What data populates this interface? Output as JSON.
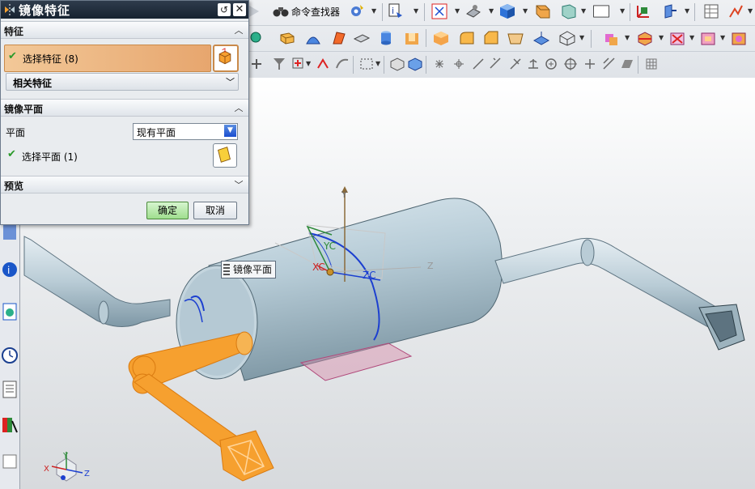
{
  "dialog": {
    "title": "镜像特征",
    "sections": {
      "features": {
        "header": "特征",
        "select_feature": "选择特征 (8)",
        "related_features": "相关特征"
      },
      "mirror_plane": {
        "header": "镜像平面",
        "plane_label": "平面",
        "plane_value": "现有平面",
        "select_plane": "选择平面 (1)"
      },
      "preview": {
        "header": "预览"
      }
    },
    "ok_label": "确定",
    "cancel_label": "取消"
  },
  "toolbar": {
    "command_finder_label": "命令查找器"
  },
  "viewport": {
    "tooltip": "镜像平面",
    "axis_labels": {
      "xc": "XC",
      "yc": "YC",
      "zc": "ZC",
      "y": "Y",
      "z": "Z",
      "x": "X"
    }
  },
  "colors": {
    "body_fill": "#b9ccd6",
    "body_dark": "#8aa3b0",
    "mirror_feature": "#f6a02f",
    "plane": "#d68aa8",
    "edge_highlight": "#1c3fd0",
    "dialog_selected": "#ebb07a"
  }
}
